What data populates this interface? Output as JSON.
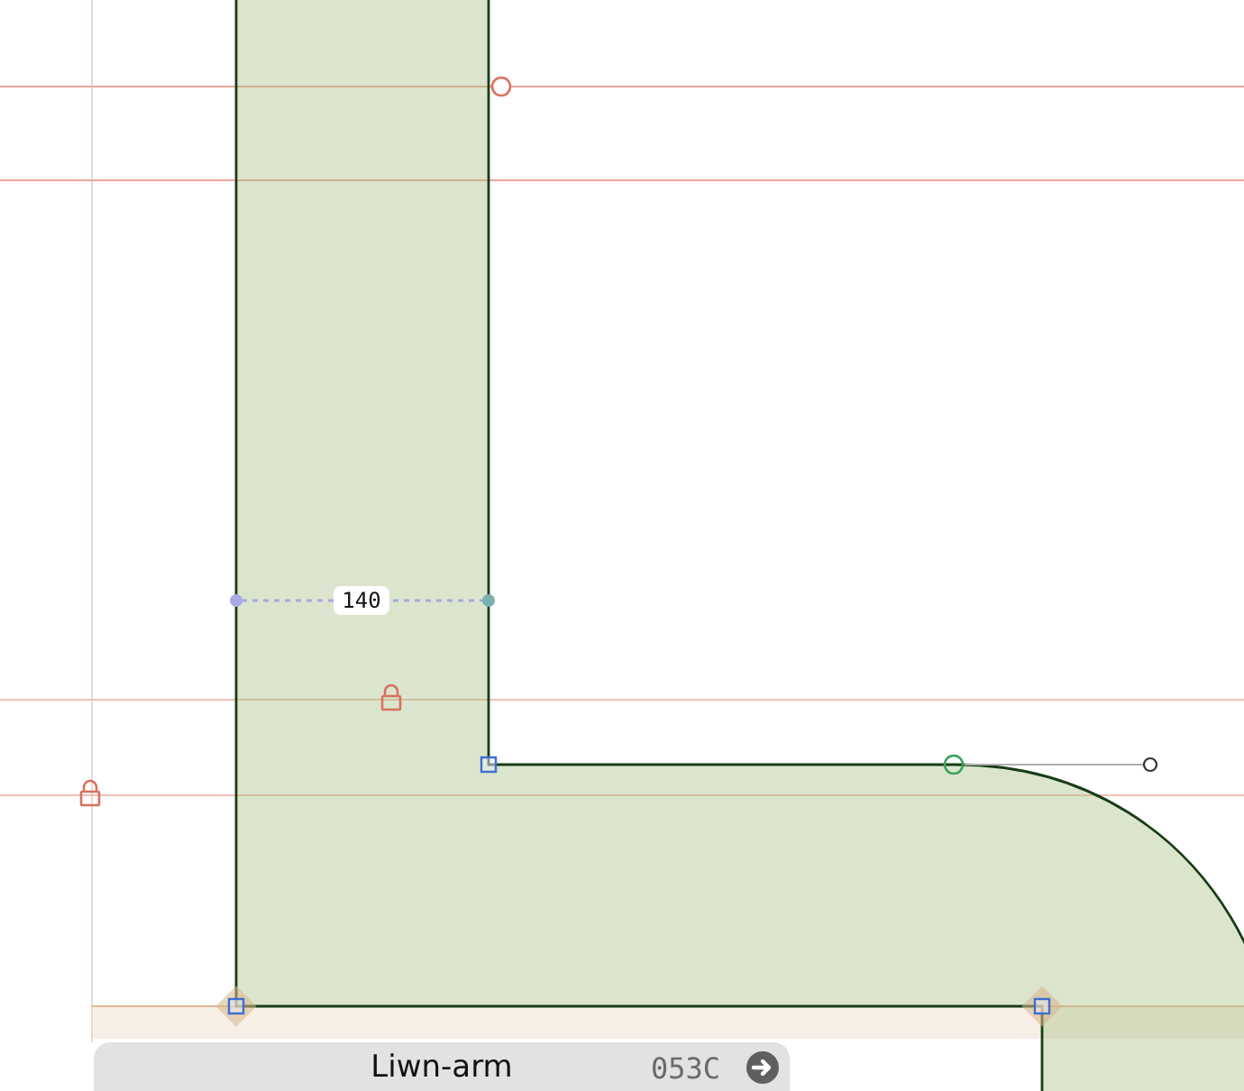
{
  "canvas": {
    "measurement": {
      "value": "140"
    }
  },
  "info_bar": {
    "glyph_name": "Liwn-arm",
    "unicode": "053C"
  }
}
